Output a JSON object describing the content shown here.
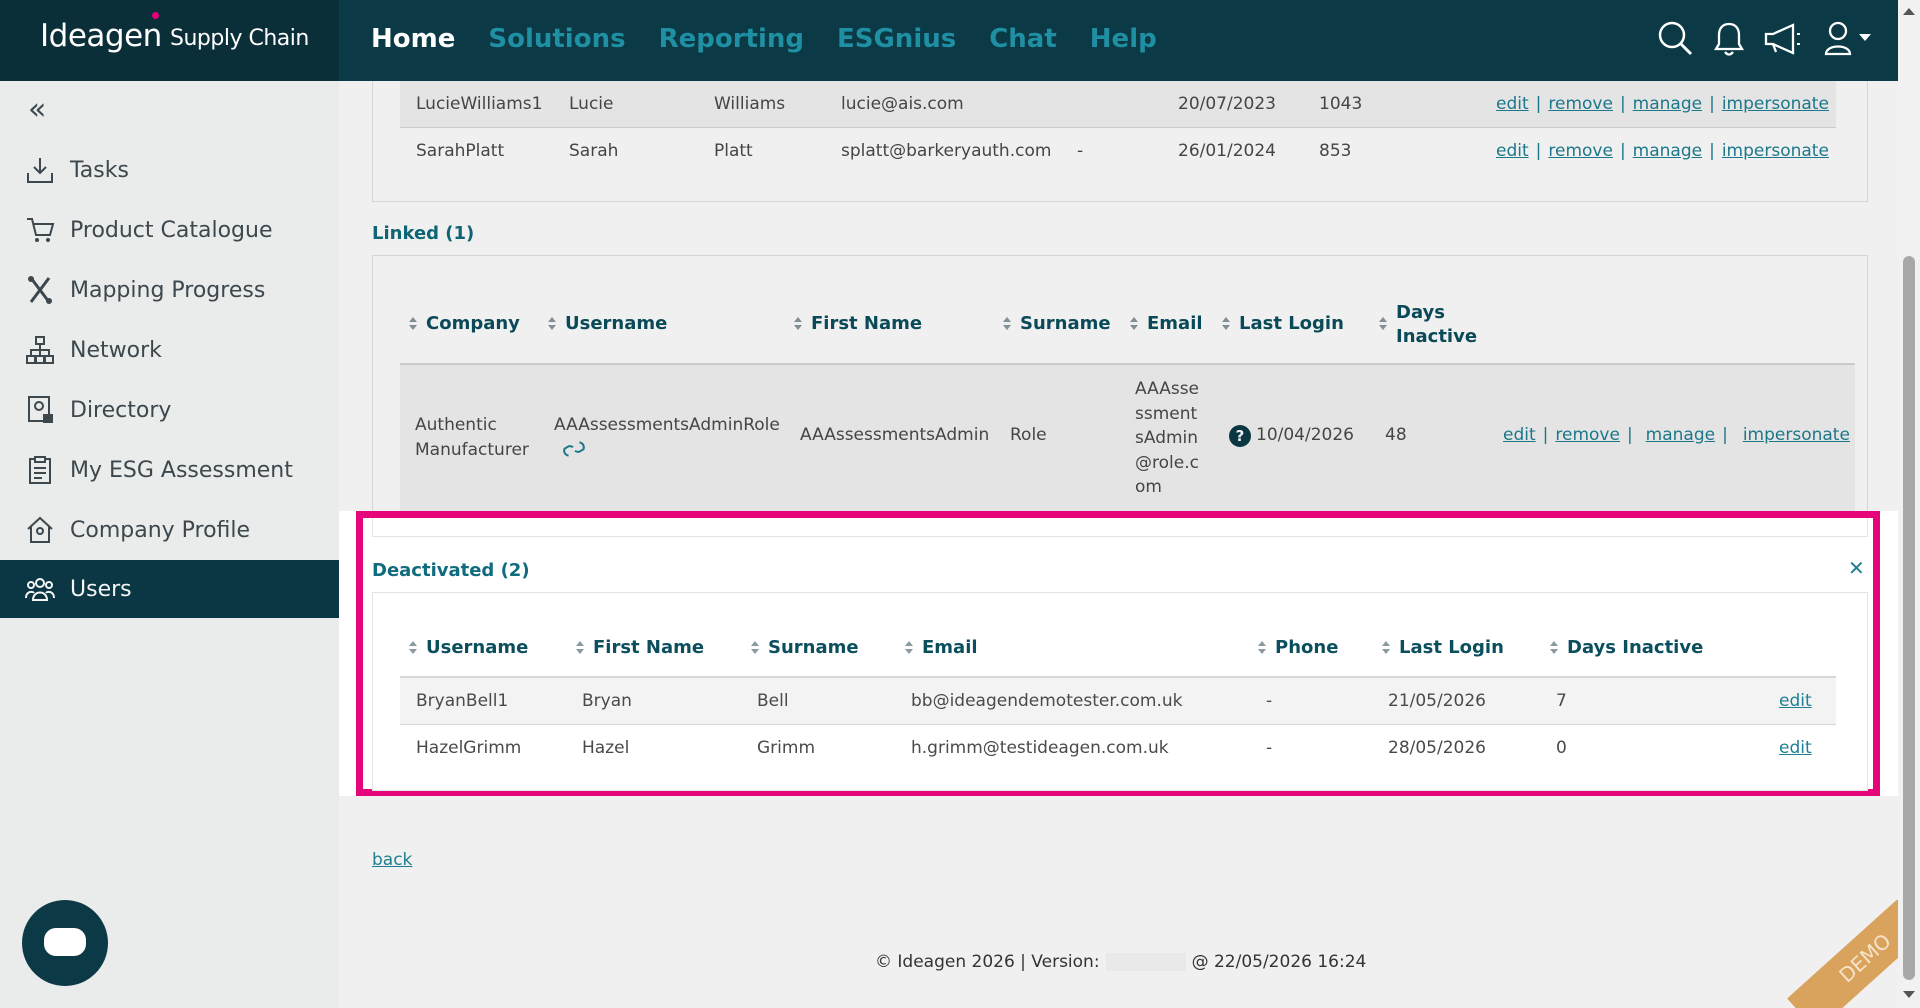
{
  "header": {
    "logo_main": "Ideagen",
    "logo_sub": "Supply Chain",
    "nav": [
      "Home",
      "Solutions",
      "Reporting",
      "ESGnius",
      "Chat",
      "Help"
    ],
    "active_nav": "Home",
    "icons": [
      "search-icon",
      "bell-icon",
      "megaphone-icon",
      "user-icon"
    ]
  },
  "sidebar": {
    "collapse_label": "«",
    "items": [
      {
        "label": "Tasks",
        "icon": "download-tray-icon"
      },
      {
        "label": "Product Catalogue",
        "icon": "cart-icon"
      },
      {
        "label": "Mapping Progress",
        "icon": "mapping-icon"
      },
      {
        "label": "Network",
        "icon": "network-icon"
      },
      {
        "label": "Directory",
        "icon": "directory-icon"
      },
      {
        "label": "My ESG Assessment",
        "icon": "clipboard-icon"
      },
      {
        "label": "Company Profile",
        "icon": "house-icon"
      },
      {
        "label": "Users",
        "icon": "users-icon"
      }
    ],
    "active_item": "Users"
  },
  "top_table": {
    "rows": [
      {
        "username": "LucieWilliams1",
        "first_name": "Lucie",
        "surname": "Williams",
        "email": "lucie@ais.com",
        "phone": "",
        "last_login": "20/07/2023",
        "days_inactive": "1043"
      },
      {
        "username": "SarahPlatt",
        "first_name": "Sarah",
        "surname": "Platt",
        "email": "splatt@barkeryauth.com",
        "phone": "-",
        "last_login": "26/01/2024",
        "days_inactive": "853"
      }
    ],
    "actions": [
      "edit",
      "remove",
      "manage",
      "impersonate"
    ]
  },
  "linked": {
    "title": "Linked (1)",
    "columns": [
      "Company",
      "Username",
      "First Name",
      "Surname",
      "Email",
      "Last Login",
      "Days",
      "Inactive"
    ],
    "row": {
      "company_line1": "Authentic",
      "company_line2": "Manufacturer",
      "username": "AAAssessmentsAdminRole",
      "first_name": "AAAssessmentsAdmin",
      "surname": "Role",
      "email_lines": [
        "AAAsse",
        "ssment",
        "sAdmin",
        "@role.c",
        "om"
      ],
      "help_glyph": "?",
      "last_login": "10/04/2026",
      "days_inactive": "48"
    },
    "actions": [
      "edit",
      "remove",
      "manage",
      "impersonate"
    ]
  },
  "deactivated": {
    "title": "Deactivated (2)",
    "close_glyph": "✕",
    "columns": [
      "Username",
      "First Name",
      "Surname",
      "Email",
      "Phone",
      "Last Login",
      "Days Inactive"
    ],
    "rows": [
      {
        "username": "BryanBell1",
        "first_name": "Bryan",
        "surname": "Bell",
        "email": "bb@ideagendemotester.com.uk",
        "phone": "-",
        "last_login": "21/05/2026",
        "days_inactive": "7",
        "action": "edit"
      },
      {
        "username": "HazelGrimm",
        "first_name": "Hazel",
        "surname": "Grimm",
        "email": "h.grimm@testideagen.com.uk",
        "phone": "-",
        "last_login": "28/05/2026",
        "days_inactive": "0",
        "action": "edit"
      }
    ]
  },
  "back_link": "back",
  "footer": {
    "left": "© Ideagen 2026 | Version:",
    "right": "@ 22/05/2026 16:24"
  },
  "demo_ribbon": "DEMO",
  "colors": {
    "header_bg": "#0b3a46",
    "accent": "#1f8fa3",
    "highlight": "#e5067c"
  }
}
